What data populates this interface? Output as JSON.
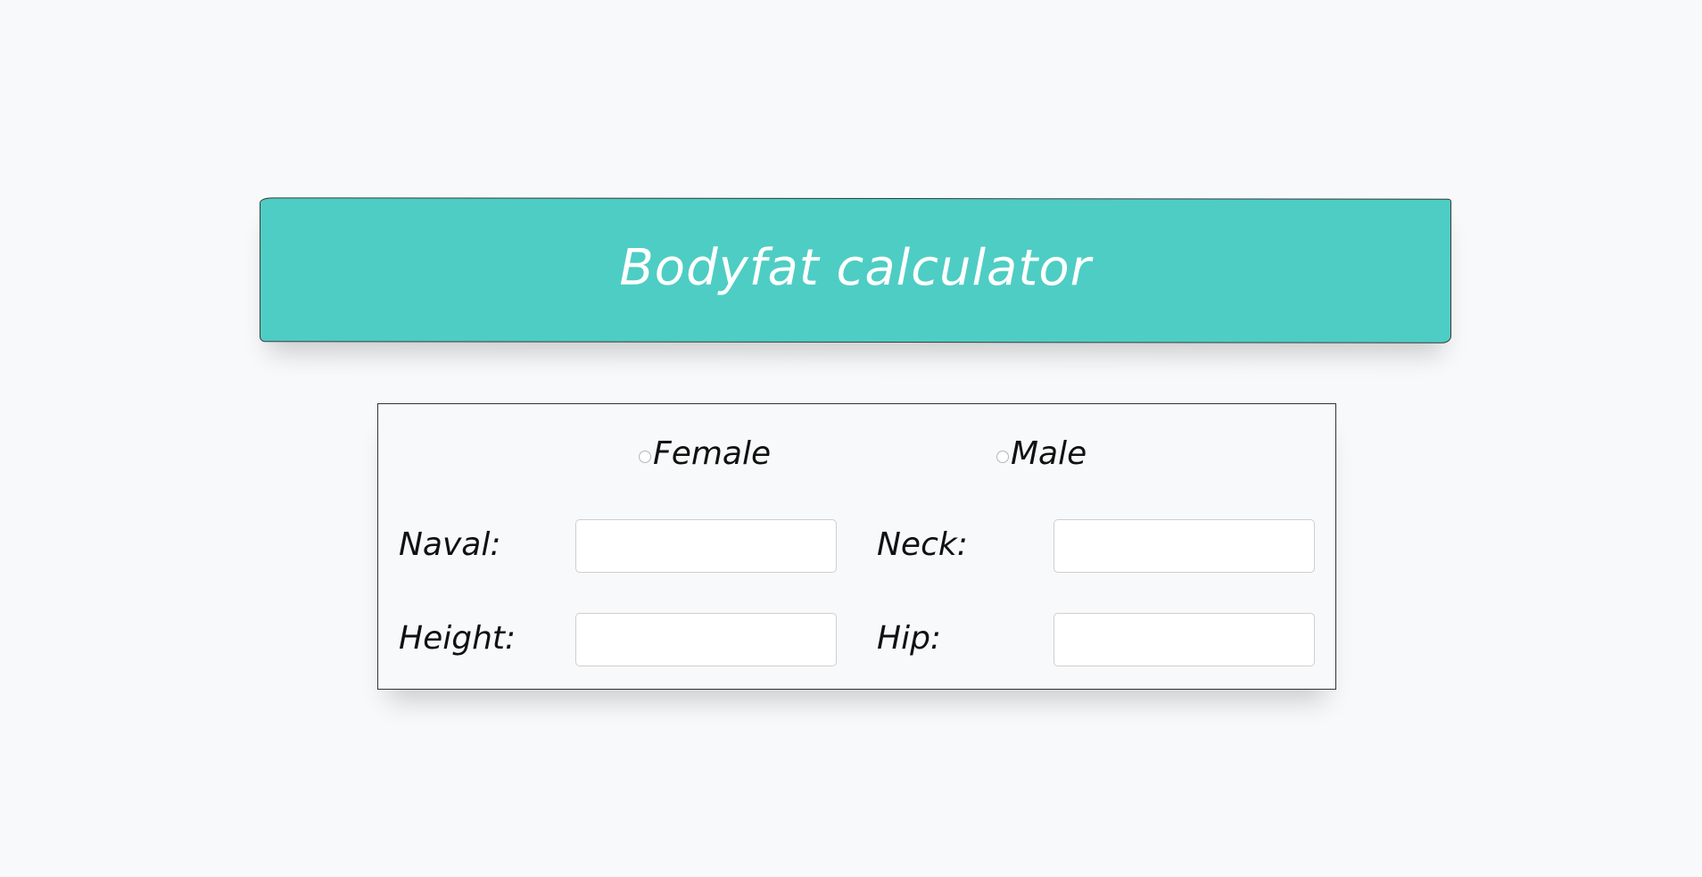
{
  "header": {
    "title": "Bodyfat calculator",
    "background_color": "#4ecdc4",
    "text_color": "#ffffff"
  },
  "form": {
    "gender_options": [
      {
        "label": "Female",
        "selected": false
      },
      {
        "label": "Male",
        "selected": false
      }
    ],
    "fields": {
      "naval": {
        "label": "Naval:",
        "value": "",
        "placeholder": ""
      },
      "neck": {
        "label": "Neck:",
        "value": "",
        "placeholder": ""
      },
      "height": {
        "label": "Height:",
        "value": "",
        "placeholder": ""
      },
      "hip": {
        "label": "Hip:",
        "value": "",
        "placeholder": ""
      }
    }
  },
  "colors": {
    "page_background": "#f8f9fa",
    "accent": "#4ecdc4",
    "border": "#333333"
  }
}
